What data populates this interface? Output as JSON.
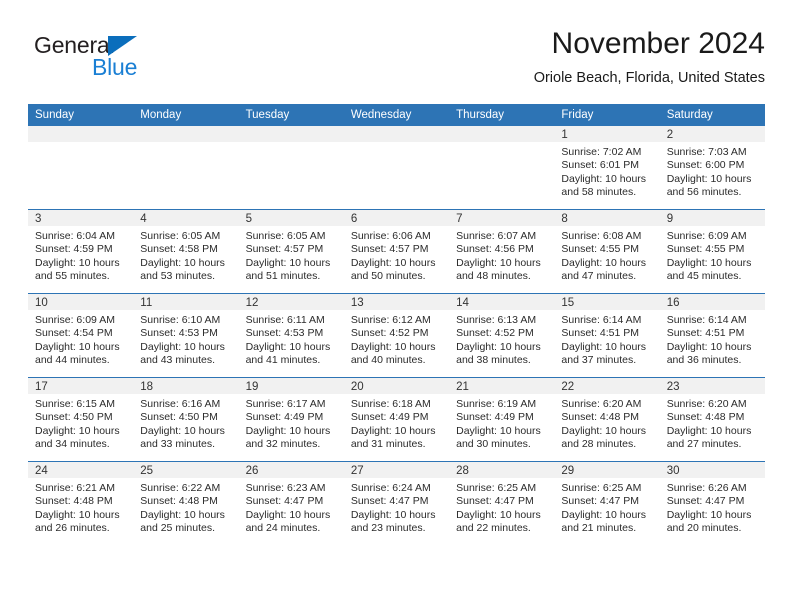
{
  "brand": {
    "name_dark": "General",
    "name_blue": "Blue",
    "color_dark": "#231f20",
    "color_blue": "#1a7fd4",
    "triangle_color": "#0b6ebc"
  },
  "header": {
    "title": "November 2024",
    "subtitle": "Oriole Beach, Florida, United States"
  },
  "theme": {
    "header_blue": "#2d74b5",
    "band_gray": "#f1f1f1",
    "text": "#2b2b2b"
  },
  "weekdays": [
    "Sunday",
    "Monday",
    "Tuesday",
    "Wednesday",
    "Thursday",
    "Friday",
    "Saturday"
  ],
  "weeks": [
    [
      {
        "day": "",
        "empty": true
      },
      {
        "day": "",
        "empty": true
      },
      {
        "day": "",
        "empty": true
      },
      {
        "day": "",
        "empty": true
      },
      {
        "day": "",
        "empty": true
      },
      {
        "day": "1",
        "sunrise": "Sunrise: 7:02 AM",
        "sunset": "Sunset: 6:01 PM",
        "daylight": "Daylight: 10 hours and 58 minutes."
      },
      {
        "day": "2",
        "sunrise": "Sunrise: 7:03 AM",
        "sunset": "Sunset: 6:00 PM",
        "daylight": "Daylight: 10 hours and 56 minutes."
      }
    ],
    [
      {
        "day": "3",
        "sunrise": "Sunrise: 6:04 AM",
        "sunset": "Sunset: 4:59 PM",
        "daylight": "Daylight: 10 hours and 55 minutes."
      },
      {
        "day": "4",
        "sunrise": "Sunrise: 6:05 AM",
        "sunset": "Sunset: 4:58 PM",
        "daylight": "Daylight: 10 hours and 53 minutes."
      },
      {
        "day": "5",
        "sunrise": "Sunrise: 6:05 AM",
        "sunset": "Sunset: 4:57 PM",
        "daylight": "Daylight: 10 hours and 51 minutes."
      },
      {
        "day": "6",
        "sunrise": "Sunrise: 6:06 AM",
        "sunset": "Sunset: 4:57 PM",
        "daylight": "Daylight: 10 hours and 50 minutes."
      },
      {
        "day": "7",
        "sunrise": "Sunrise: 6:07 AM",
        "sunset": "Sunset: 4:56 PM",
        "daylight": "Daylight: 10 hours and 48 minutes."
      },
      {
        "day": "8",
        "sunrise": "Sunrise: 6:08 AM",
        "sunset": "Sunset: 4:55 PM",
        "daylight": "Daylight: 10 hours and 47 minutes."
      },
      {
        "day": "9",
        "sunrise": "Sunrise: 6:09 AM",
        "sunset": "Sunset: 4:55 PM",
        "daylight": "Daylight: 10 hours and 45 minutes."
      }
    ],
    [
      {
        "day": "10",
        "sunrise": "Sunrise: 6:09 AM",
        "sunset": "Sunset: 4:54 PM",
        "daylight": "Daylight: 10 hours and 44 minutes."
      },
      {
        "day": "11",
        "sunrise": "Sunrise: 6:10 AM",
        "sunset": "Sunset: 4:53 PM",
        "daylight": "Daylight: 10 hours and 43 minutes."
      },
      {
        "day": "12",
        "sunrise": "Sunrise: 6:11 AM",
        "sunset": "Sunset: 4:53 PM",
        "daylight": "Daylight: 10 hours and 41 minutes."
      },
      {
        "day": "13",
        "sunrise": "Sunrise: 6:12 AM",
        "sunset": "Sunset: 4:52 PM",
        "daylight": "Daylight: 10 hours and 40 minutes."
      },
      {
        "day": "14",
        "sunrise": "Sunrise: 6:13 AM",
        "sunset": "Sunset: 4:52 PM",
        "daylight": "Daylight: 10 hours and 38 minutes."
      },
      {
        "day": "15",
        "sunrise": "Sunrise: 6:14 AM",
        "sunset": "Sunset: 4:51 PM",
        "daylight": "Daylight: 10 hours and 37 minutes."
      },
      {
        "day": "16",
        "sunrise": "Sunrise: 6:14 AM",
        "sunset": "Sunset: 4:51 PM",
        "daylight": "Daylight: 10 hours and 36 minutes."
      }
    ],
    [
      {
        "day": "17",
        "sunrise": "Sunrise: 6:15 AM",
        "sunset": "Sunset: 4:50 PM",
        "daylight": "Daylight: 10 hours and 34 minutes."
      },
      {
        "day": "18",
        "sunrise": "Sunrise: 6:16 AM",
        "sunset": "Sunset: 4:50 PM",
        "daylight": "Daylight: 10 hours and 33 minutes."
      },
      {
        "day": "19",
        "sunrise": "Sunrise: 6:17 AM",
        "sunset": "Sunset: 4:49 PM",
        "daylight": "Daylight: 10 hours and 32 minutes."
      },
      {
        "day": "20",
        "sunrise": "Sunrise: 6:18 AM",
        "sunset": "Sunset: 4:49 PM",
        "daylight": "Daylight: 10 hours and 31 minutes."
      },
      {
        "day": "21",
        "sunrise": "Sunrise: 6:19 AM",
        "sunset": "Sunset: 4:49 PM",
        "daylight": "Daylight: 10 hours and 30 minutes."
      },
      {
        "day": "22",
        "sunrise": "Sunrise: 6:20 AM",
        "sunset": "Sunset: 4:48 PM",
        "daylight": "Daylight: 10 hours and 28 minutes."
      },
      {
        "day": "23",
        "sunrise": "Sunrise: 6:20 AM",
        "sunset": "Sunset: 4:48 PM",
        "daylight": "Daylight: 10 hours and 27 minutes."
      }
    ],
    [
      {
        "day": "24",
        "sunrise": "Sunrise: 6:21 AM",
        "sunset": "Sunset: 4:48 PM",
        "daylight": "Daylight: 10 hours and 26 minutes."
      },
      {
        "day": "25",
        "sunrise": "Sunrise: 6:22 AM",
        "sunset": "Sunset: 4:48 PM",
        "daylight": "Daylight: 10 hours and 25 minutes."
      },
      {
        "day": "26",
        "sunrise": "Sunrise: 6:23 AM",
        "sunset": "Sunset: 4:47 PM",
        "daylight": "Daylight: 10 hours and 24 minutes."
      },
      {
        "day": "27",
        "sunrise": "Sunrise: 6:24 AM",
        "sunset": "Sunset: 4:47 PM",
        "daylight": "Daylight: 10 hours and 23 minutes."
      },
      {
        "day": "28",
        "sunrise": "Sunrise: 6:25 AM",
        "sunset": "Sunset: 4:47 PM",
        "daylight": "Daylight: 10 hours and 22 minutes."
      },
      {
        "day": "29",
        "sunrise": "Sunrise: 6:25 AM",
        "sunset": "Sunset: 4:47 PM",
        "daylight": "Daylight: 10 hours and 21 minutes."
      },
      {
        "day": "30",
        "sunrise": "Sunrise: 6:26 AM",
        "sunset": "Sunset: 4:47 PM",
        "daylight": "Daylight: 10 hours and 20 minutes."
      }
    ]
  ]
}
